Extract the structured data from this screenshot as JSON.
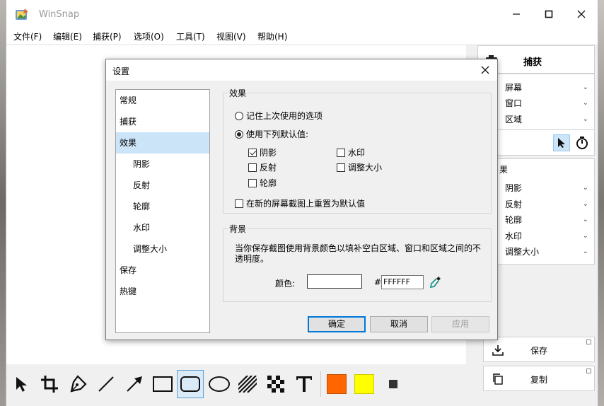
{
  "app": {
    "title": "WinSnap"
  },
  "menu": [
    "文件(F)",
    "编辑(E)",
    "捕获(P)",
    "选项(O)",
    "工具(T)",
    "视图(V)",
    "帮助(H)"
  ],
  "right_panel": {
    "capture_label": "捕获",
    "capture_items": [
      "屏幕",
      "窗口",
      "区域"
    ],
    "effects_header": "果",
    "effect_items": [
      "阴影",
      "反射",
      "轮廓",
      "水印",
      "调整大小"
    ],
    "save_label": "保存",
    "copy_label": "复制"
  },
  "toolbar": {
    "tools": [
      "pointer-icon",
      "crop-icon",
      "pen-icon",
      "line-icon",
      "arrow-icon",
      "rectangle-icon",
      "rounded-rectangle-icon",
      "ellipse-icon",
      "hatch-icon",
      "pixelate-icon",
      "text-icon"
    ],
    "selected_tool": "rounded-rectangle-icon",
    "color1": "#ff6600",
    "color2": "#ffff00",
    "color3": "#333333"
  },
  "dialog": {
    "title": "设置",
    "nav": [
      {
        "label": "常规",
        "sub": false
      },
      {
        "label": "捕获",
        "sub": false
      },
      {
        "label": "效果",
        "sub": false,
        "selected": true
      },
      {
        "label": "阴影",
        "sub": true
      },
      {
        "label": "反射",
        "sub": true
      },
      {
        "label": "轮廓",
        "sub": true
      },
      {
        "label": "水印",
        "sub": true
      },
      {
        "label": "调整大小",
        "sub": true
      },
      {
        "label": "保存",
        "sub": false
      },
      {
        "label": "热键",
        "sub": false
      }
    ],
    "effects_group": {
      "label": "效果",
      "radio_remember": "记住上次使用的选项",
      "radio_defaults": "使用下列默认值:",
      "cb_shadow": "阴影",
      "cb_watermark": "水印",
      "cb_reflection": "反射",
      "cb_resize": "调整大小",
      "cb_outline": "轮廓",
      "cb_reset": "在新的屏幕截图上重置为默认值"
    },
    "background_group": {
      "label": "背景",
      "description": "当你保存截图使用背景颜色以填补空白区域、窗口和区域之间的不透明度。",
      "color_label": "颜色:",
      "hash": "#",
      "hex_value": "FFFFFF"
    },
    "buttons": {
      "ok": "确定",
      "cancel": "取消",
      "apply": "应用"
    }
  }
}
